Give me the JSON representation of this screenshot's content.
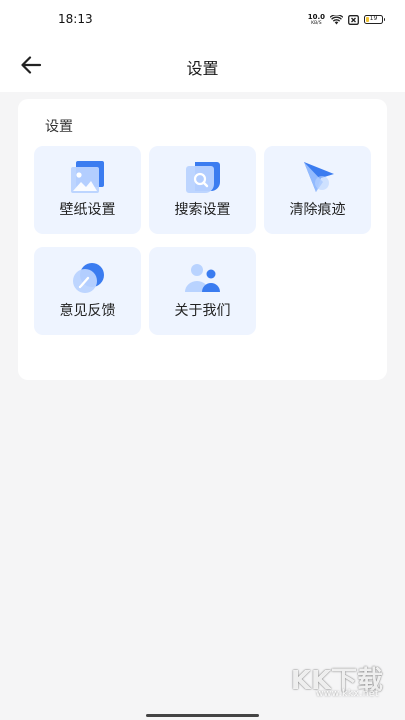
{
  "status_bar": {
    "time": "18:13",
    "net_speed_value": "10.0",
    "net_speed_unit": "KB/S",
    "battery_level": "19",
    "battery_fraction": 0.19,
    "icons": [
      "wifi-icon",
      "sim-disabled-icon",
      "battery-icon"
    ]
  },
  "nav": {
    "title": "设置",
    "back_icon": "arrow-left-icon"
  },
  "settings_section": {
    "title": "设置",
    "items": [
      {
        "label": "壁纸设置",
        "icon": "wallpaper-icon"
      },
      {
        "label": "搜索设置",
        "icon": "search-settings-icon"
      },
      {
        "label": "清除痕迹",
        "icon": "clear-history-icon"
      },
      {
        "label": "意见反馈",
        "icon": "feedback-icon"
      },
      {
        "label": "关于我们",
        "icon": "about-us-icon"
      }
    ]
  },
  "watermark": {
    "brand": "KK下载",
    "url": "www.kkx.net"
  },
  "colors": {
    "accent": "#3b7cf0",
    "accent_light": "#9cc1ff",
    "tile_bg": "#eef4ff",
    "page_bg": "#f5f5f6"
  }
}
